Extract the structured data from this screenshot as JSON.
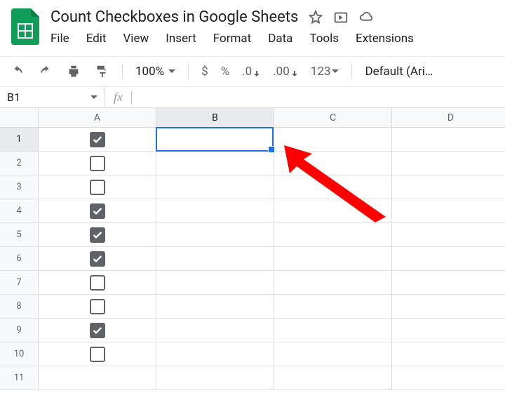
{
  "doc_title": "Count Checkboxes in Google Sheets",
  "menu": {
    "file": "File",
    "edit": "Edit",
    "view": "View",
    "insert": "Insert",
    "format": "Format",
    "data": "Data",
    "tools": "Tools",
    "extensions": "Extensions"
  },
  "toolbar": {
    "zoom": "100%",
    "currency": "$",
    "percent": "%",
    "dec_decrease": ".0",
    "dec_increase": ".00",
    "number_format": "123",
    "font": "Default (Ari…"
  },
  "name_box": "B1",
  "fx_label": "fx",
  "columns": [
    "A",
    "B",
    "C",
    "D"
  ],
  "selected_column": "B",
  "selected_row": "1",
  "rows": [
    "1",
    "2",
    "3",
    "4",
    "5",
    "6",
    "7",
    "8",
    "9",
    "10",
    "11"
  ],
  "checkboxes": [
    true,
    false,
    false,
    true,
    true,
    true,
    false,
    false,
    true,
    false
  ]
}
